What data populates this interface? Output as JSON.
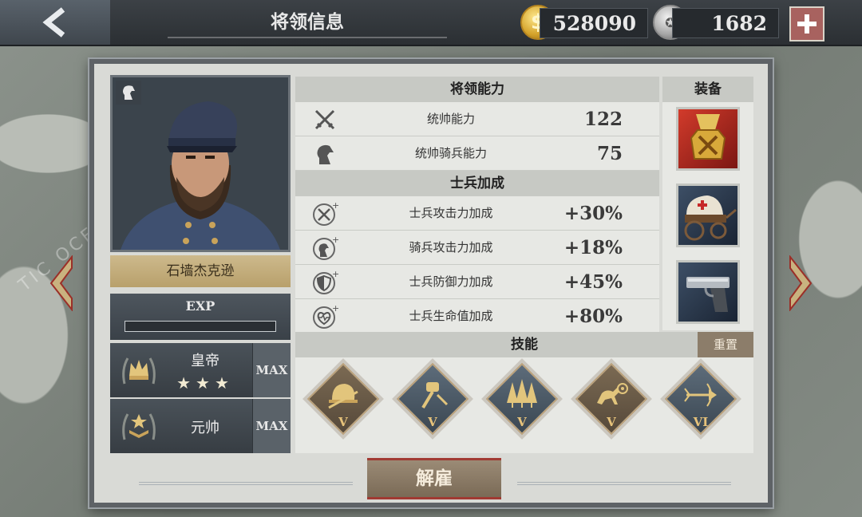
{
  "header": {
    "title": "将领信息",
    "gold": "528090",
    "medals": "1682"
  },
  "general": {
    "name": "石墙杰克逊",
    "exp_label": "EXP",
    "exp_fraction": 0.0,
    "rank1": {
      "title": "皇帝",
      "stars": "★★★",
      "max": "MAX"
    },
    "rank2": {
      "title": "元帅",
      "max": "MAX"
    }
  },
  "ability": {
    "heading": "将领能力",
    "rows": [
      {
        "icon": "crossed-swords-icon",
        "label": "统帅能力",
        "value": "122"
      },
      {
        "icon": "horse-head-icon",
        "label": "统帅骑兵能力",
        "value": "75"
      }
    ]
  },
  "bonus": {
    "heading": "士兵加成",
    "rows": [
      {
        "icon": "attack-up-icon",
        "label": "士兵攻击力加成",
        "value": "+30%"
      },
      {
        "icon": "cavalry-attack-up-icon",
        "label": "骑兵攻击力加成",
        "value": "+18%"
      },
      {
        "icon": "defense-up-icon",
        "label": "士兵防御力加成",
        "value": "+45%"
      },
      {
        "icon": "health-up-icon",
        "label": "士兵生命值加成",
        "value": "+80%"
      }
    ]
  },
  "equipment": {
    "heading": "装备",
    "items": [
      "medal-icon",
      "ambulance-wagon-icon",
      "pistol-icon"
    ]
  },
  "skills": {
    "heading": "技能",
    "reset_label": "重置",
    "items": [
      {
        "icon": "helmet-skill-icon",
        "level": "V",
        "style": "gold"
      },
      {
        "icon": "hammer-skill-icon",
        "level": "V",
        "style": "blue"
      },
      {
        "icon": "forest-skill-icon",
        "level": "V",
        "style": "blue"
      },
      {
        "icon": "cavalry-skill-icon",
        "level": "V",
        "style": "gold"
      },
      {
        "icon": "arrow-skill-icon",
        "level": "VI",
        "style": "blue"
      }
    ]
  },
  "actions": {
    "dismiss_label": "解雇"
  },
  "map": {
    "ocean_label": "TIC OCEAN"
  },
  "colors": {
    "accent_red": "#a13a33",
    "gold_plate": "#cdb98c",
    "panel": "#d9dad6"
  }
}
